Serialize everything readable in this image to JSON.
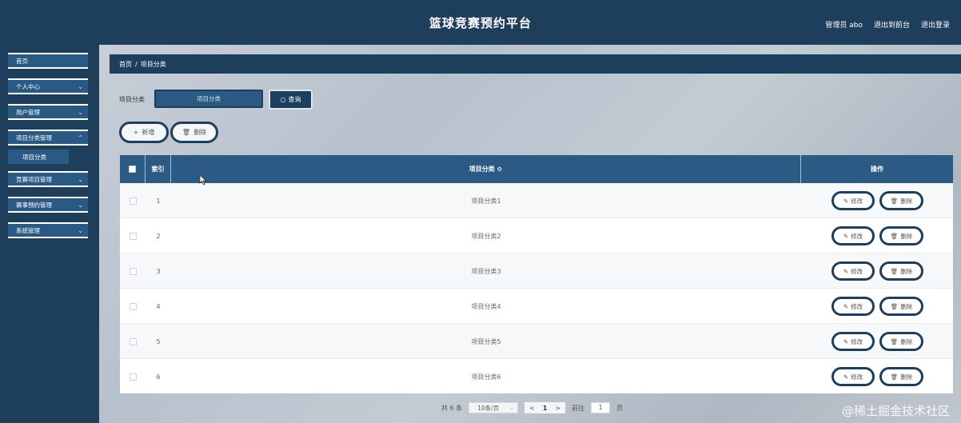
{
  "header": {
    "title": "篮球竞赛预约平台",
    "admin": "管理员 abo",
    "to_front": "退出到前台",
    "logout": "退出登录"
  },
  "sidebar": {
    "items": [
      {
        "label": "首页"
      },
      {
        "label": "个人中心"
      },
      {
        "label": "用户管理"
      },
      {
        "label": "项目分类管理"
      },
      {
        "label": "项目分类"
      },
      {
        "label": "竞赛项目管理"
      },
      {
        "label": "赛事预约管理"
      },
      {
        "label": "系统管理"
      }
    ]
  },
  "breadcrumb": {
    "home": "首页",
    "sep": "/",
    "current": "项目分类"
  },
  "search": {
    "label": "项目分类",
    "placeholder": "项目分类",
    "query_label": "查询"
  },
  "toolbar": {
    "add_label": "新增",
    "delete_label": "删除"
  },
  "table": {
    "headers": {
      "index": "索引",
      "category": "项目分类 ≎",
      "action": "操作"
    },
    "rows": [
      {
        "index": "1",
        "category": "项目分类1"
      },
      {
        "index": "2",
        "category": "项目分类2"
      },
      {
        "index": "3",
        "category": "项目分类3"
      },
      {
        "index": "4",
        "category": "项目分类4"
      },
      {
        "index": "5",
        "category": "项目分类5"
      },
      {
        "index": "6",
        "category": "项目分类6"
      }
    ],
    "edit_label": "修改",
    "delete_label": "删除"
  },
  "pagination": {
    "total": "共 6 条",
    "page_size": "10条/页",
    "prev": "<",
    "current": "1",
    "next": ">",
    "goto_label": "前往",
    "goto_value": "1",
    "page_suffix": "页"
  },
  "watermark": "@稀土掘金技术社区",
  "colors": {
    "primary": "#1d3f5e",
    "accent": "#2a5a84"
  }
}
